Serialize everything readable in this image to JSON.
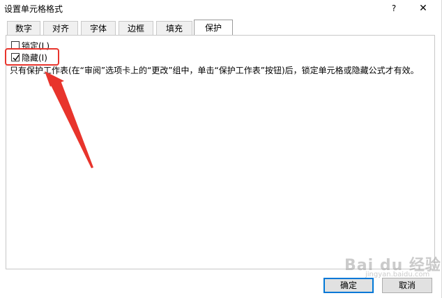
{
  "window": {
    "title": "设置单元格格式",
    "help_label": "?",
    "close_label": "✕"
  },
  "tabs": [
    {
      "label": "数字"
    },
    {
      "label": "对齐"
    },
    {
      "label": "字体"
    },
    {
      "label": "边框"
    },
    {
      "label": "填充"
    },
    {
      "label": "保护"
    }
  ],
  "active_tab": "保护",
  "protection": {
    "locked": {
      "label": "锁定(L)",
      "checked": false
    },
    "hidden": {
      "label": "隐藏(I)",
      "checked": true
    },
    "description": "只有保护工作表(在“审阅”选项卡上的“更改”组中，单击“保护工作表”按钮)后，锁定单元格或隐藏公式才有效。"
  },
  "buttons": {
    "ok_label": "确定",
    "cancel_label": "取消"
  },
  "watermark": {
    "text": "Bai du 经验",
    "sub": "jingyan.baidu.com"
  },
  "colors": {
    "annotation": "#e8342c",
    "default_button_border": "#0078d7"
  }
}
